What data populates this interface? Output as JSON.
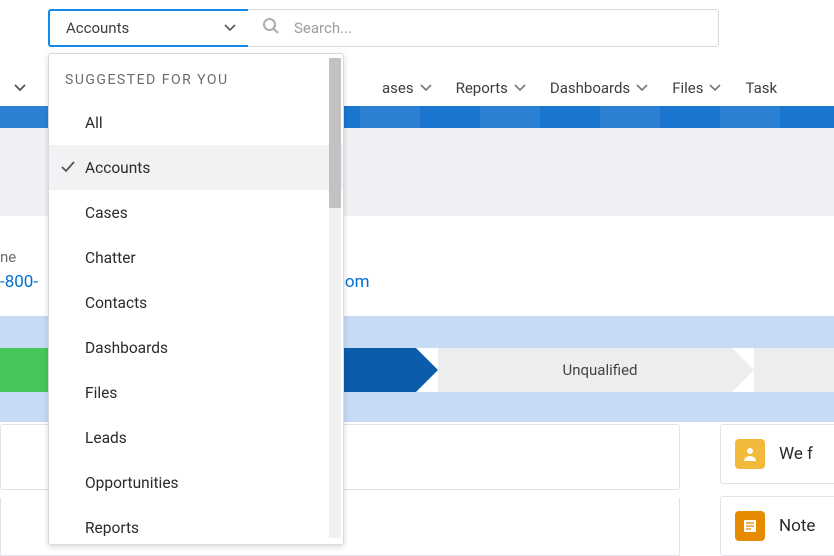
{
  "search": {
    "combo_label": "Accounts",
    "placeholder": "Search..."
  },
  "nav": {
    "items": [
      "ases",
      "Reports",
      "Dashboards",
      "Files",
      "Task"
    ]
  },
  "record": {
    "phone_label": "ne",
    "phone_value": "-800-",
    "website_value": "com"
  },
  "path": {
    "stage": "Unqualified"
  },
  "sidebar": {
    "card1_text": "We f",
    "card2_text": "Note"
  },
  "dropdown": {
    "header": "SUGGESTED FOR YOU",
    "items": [
      "All",
      "Accounts",
      "Cases",
      "Chatter",
      "Contacts",
      "Dashboards",
      "Files",
      "Leads",
      "Opportunities",
      "Reports"
    ],
    "selected_index": 1
  }
}
